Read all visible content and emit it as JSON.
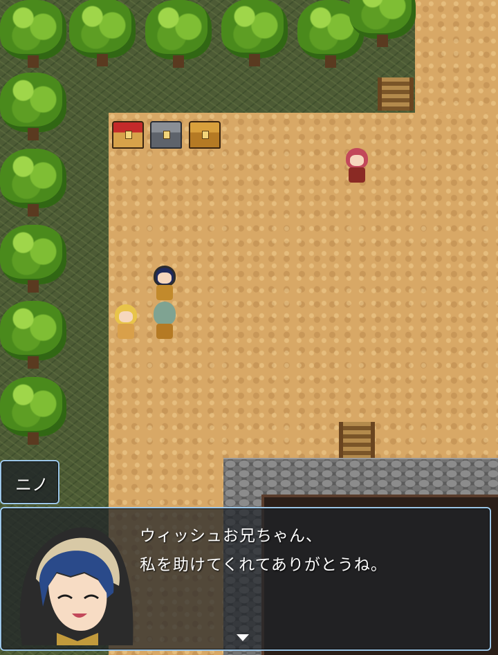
{
  "dialogue": {
    "speaker_name": "ニノ",
    "lines": [
      "ウィッシュお兄ちゃん、",
      "私を助けてくれてありがとうね。"
    ],
    "continue_indicator": "down-triangle-icon"
  },
  "colors": {
    "window_border": "#9cc6e8",
    "window_fill": "#1e2228",
    "dirt": "#d8a866",
    "forest_floor": "#4d5b35",
    "tree_leaf": "#7fbe34",
    "stone": "#737373"
  }
}
